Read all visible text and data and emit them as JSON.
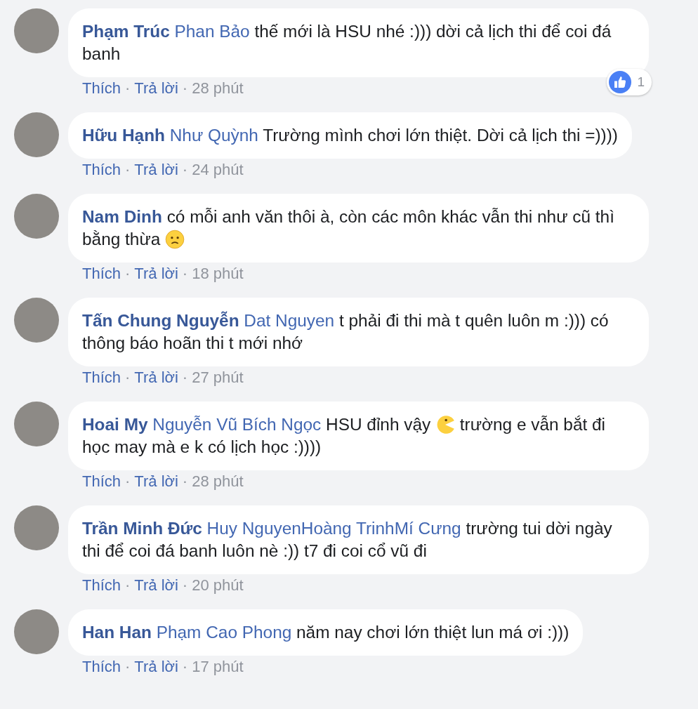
{
  "comments": [
    {
      "author": "Phạm Trúc",
      "mention": "Phan Bảo",
      "parts": [
        {
          "kind": "text",
          "text": "thế mới là HSU nhé :))) dời cả lịch thi để coi đá banh"
        }
      ],
      "actions": [
        {
          "kind": "link",
          "text": "Thích"
        },
        {
          "kind": "sep",
          "text": "·"
        },
        {
          "kind": "link",
          "text": "Trả lời"
        },
        {
          "kind": "sep",
          "text": "·"
        },
        {
          "kind": "time",
          "text": "28 phút"
        }
      ],
      "reactions": {
        "count": "1"
      }
    },
    {
      "author": "Hữu Hạnh",
      "mention": "Như Quỳnh",
      "parts": [
        {
          "kind": "text",
          "text": "Trường mình chơi lớn thiệt. Dời cả lịch thi =))))"
        }
      ],
      "actions": [
        {
          "kind": "link",
          "text": "Thích"
        },
        {
          "kind": "sep",
          "text": "·"
        },
        {
          "kind": "link",
          "text": "Trả lời"
        },
        {
          "kind": "sep",
          "text": "·"
        },
        {
          "kind": "time",
          "text": "24 phút"
        }
      ]
    },
    {
      "author": "Nam Dinh",
      "parts": [
        {
          "kind": "text",
          "text": "có mỗi anh văn thôi à, còn các môn khác vẫn thi như cũ thì bằng thừa"
        },
        {
          "kind": "worried"
        }
      ],
      "actions": [
        {
          "kind": "link",
          "text": "Thích"
        },
        {
          "kind": "sep",
          "text": "·"
        },
        {
          "kind": "link",
          "text": "Trả lời"
        },
        {
          "kind": "sep",
          "text": "·"
        },
        {
          "kind": "time",
          "text": "18 phút"
        }
      ]
    },
    {
      "author": "Tấn Chung Nguyễn",
      "mention": "Dat Nguyen",
      "parts": [
        {
          "kind": "text",
          "text": "t phải đi thi mà t quên luôn m :))) có thông báo hoãn thi t mới nhớ"
        }
      ],
      "actions": [
        {
          "kind": "link",
          "text": "Thích"
        },
        {
          "kind": "sep",
          "text": "·"
        },
        {
          "kind": "link",
          "text": "Trả lời"
        },
        {
          "kind": "sep",
          "text": "·"
        },
        {
          "kind": "time",
          "text": "27 phút"
        }
      ]
    },
    {
      "author": "Hoai My",
      "mention": "Nguyễn Vũ Bích Ngọc",
      "parts": [
        {
          "kind": "text",
          "text": "HSU đỉnh vậy"
        },
        {
          "kind": "pacman"
        },
        {
          "kind": "text",
          "text": "trường e vẫn bắt đi học may mà e k có lịch học :))))"
        }
      ],
      "actions": [
        {
          "kind": "link",
          "text": "Thích"
        },
        {
          "kind": "sep",
          "text": "·"
        },
        {
          "kind": "link",
          "text": "Trả lời"
        },
        {
          "kind": "sep",
          "text": "·"
        },
        {
          "kind": "time",
          "text": "28 phút"
        }
      ]
    },
    {
      "author": "Trần Minh Đức",
      "mention": "Huy NguyenHoàng TrinhMí Cưng",
      "parts": [
        {
          "kind": "text",
          "text": "trường tui dời ngày thi để coi đá banh luôn nè :)) t7 đi coi cổ vũ đi"
        }
      ],
      "actions": [
        {
          "kind": "link",
          "text": "Thích"
        },
        {
          "kind": "sep",
          "text": "·"
        },
        {
          "kind": "link",
          "text": "Trả lời"
        },
        {
          "kind": "sep",
          "text": "·"
        },
        {
          "kind": "time",
          "text": "20 phút"
        }
      ]
    },
    {
      "author": "Han Han",
      "mention": "Phạm Cao Phong",
      "parts": [
        {
          "kind": "text",
          "text": "năm nay chơi lớn thiệt lun má ơi :)))"
        }
      ],
      "actions": [
        {
          "kind": "link",
          "text": "Thích"
        },
        {
          "kind": "sep",
          "text": "·"
        },
        {
          "kind": "link",
          "text": "Trả lời"
        },
        {
          "kind": "sep",
          "text": "·"
        },
        {
          "kind": "time",
          "text": "17 phút"
        }
      ]
    }
  ]
}
